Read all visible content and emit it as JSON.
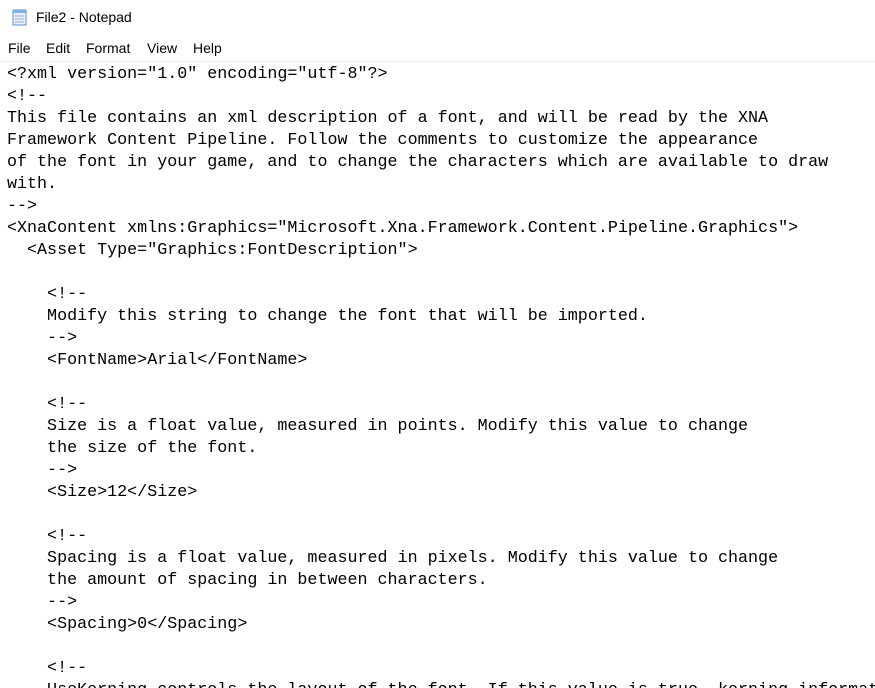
{
  "window": {
    "title": "File2 - Notepad",
    "icon": "notepad-icon"
  },
  "menu": {
    "items": [
      "File",
      "Edit",
      "Format",
      "View",
      "Help"
    ]
  },
  "editor": {
    "lines": [
      "<?xml version=\"1.0\" encoding=\"utf-8\"?>",
      "<!--",
      "This file contains an xml description of a font, and will be read by the XNA",
      "Framework Content Pipeline. Follow the comments to customize the appearance",
      "of the font in your game, and to change the characters which are available to draw",
      "with.",
      "-->",
      "<XnaContent xmlns:Graphics=\"Microsoft.Xna.Framework.Content.Pipeline.Graphics\">",
      "  <Asset Type=\"Graphics:FontDescription\">",
      "",
      "    <!--",
      "    Modify this string to change the font that will be imported.",
      "    -->",
      "    <FontName>Arial</FontName>",
      "",
      "    <!--",
      "    Size is a float value, measured in points. Modify this value to change",
      "    the size of the font.",
      "    -->",
      "    <Size>12</Size>",
      "",
      "    <!--",
      "    Spacing is a float value, measured in pixels. Modify this value to change",
      "    the amount of spacing in between characters.",
      "    -->",
      "    <Spacing>0</Spacing>",
      "",
      "    <!--",
      "    UseKerning controls the layout of the font. If this value is true, kerning informat"
    ]
  }
}
